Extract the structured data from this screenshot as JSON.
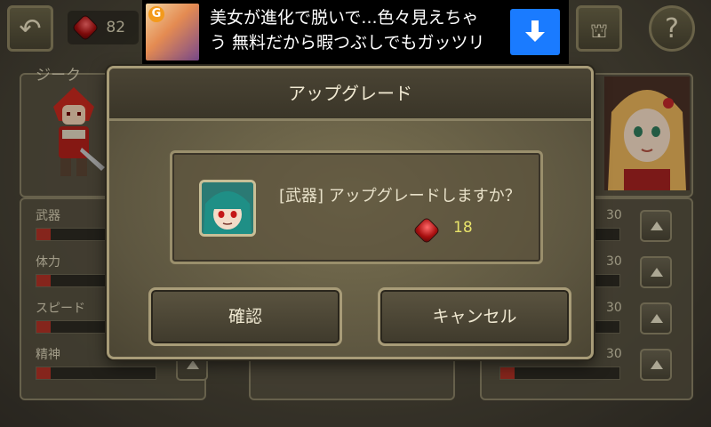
{
  "gems": {
    "count": "82"
  },
  "character": {
    "name": "ジーク"
  },
  "stats": [
    {
      "label": "武器",
      "level": 0.12
    },
    {
      "label": "体力",
      "level": 0.12
    },
    {
      "label": "スピード",
      "level": 0.12
    },
    {
      "label": "精神",
      "level": 0.12
    }
  ],
  "right_stats": [
    {
      "value": "30"
    },
    {
      "value": "30"
    },
    {
      "value": "30"
    },
    {
      "value": "30"
    }
  ],
  "ad": {
    "line1": "美女が進化で脱いで...色々見えちゃ",
    "line2": "う 無料だから暇つぶしでもガッツリ",
    "logo_letter": "G"
  },
  "dialog": {
    "title": "アップグレード",
    "message": "[武器] アップグレードしますか？",
    "cost": "18",
    "confirm_label": "確認",
    "cancel_label": "キャンセル"
  },
  "colors": {
    "gem": "#b0141a",
    "cost_text": "#e8e36a",
    "stat_fill": "#b23226"
  }
}
